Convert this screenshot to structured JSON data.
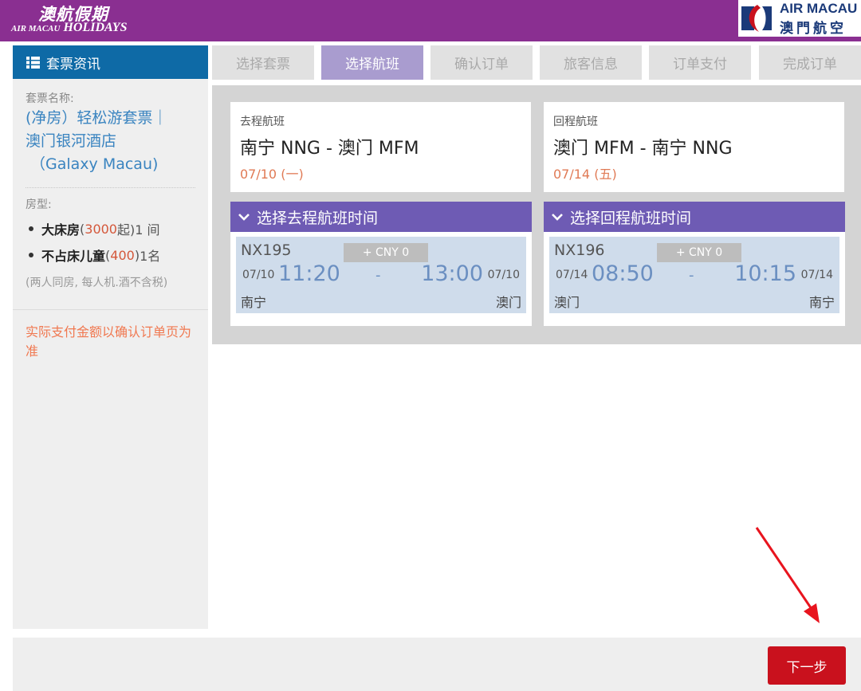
{
  "header": {
    "brand_cn": "澳航假期",
    "brand_en_prefix": "AIR MACAU",
    "brand_en_suffix": "HOLIDAYS",
    "airline_en": "AIR MACAU",
    "airline_cn": "澳門航空",
    "colors": {
      "header_bg": "#8a2f91"
    }
  },
  "sidebar": {
    "title": "套票资讯",
    "title_icon": "list-icon",
    "package_label": "套票名称:",
    "package_name_line1": "(净房）轻松游套票｜",
    "package_name_line2": "澳门银河酒店",
    "package_name_line3": "（Galaxy Macau)",
    "room_label": "房型:",
    "rooms": [
      {
        "name": "大床房",
        "price_open": "(",
        "price": "3000",
        "price_close": "起) ",
        "qty": "1 间"
      },
      {
        "name": "不占床儿童",
        "price_open": " (",
        "price": "400",
        "price_close": ") ",
        "qty": "1名"
      }
    ],
    "note": "(两人同房, 每人机.酒不含税)",
    "warning": "实际支付金额以确认订单页为准"
  },
  "steps": [
    {
      "label": "选择套票",
      "active": false
    },
    {
      "label": "选择航班",
      "active": true
    },
    {
      "label": "确认订单",
      "active": false
    },
    {
      "label": "旅客信息",
      "active": false
    },
    {
      "label": "订单支付",
      "active": false
    },
    {
      "label": "完成订单",
      "active": false
    }
  ],
  "outbound": {
    "label": "去程航班",
    "route": "南宁 NNG - 澳门 MFM",
    "date": "07/10 (一)",
    "select_title": "选择去程航班时间",
    "flight": {
      "number": "NX195",
      "price": "+ CNY 0",
      "dep_date": "07/10",
      "dep_time": "11:20",
      "separator": "-",
      "arr_time": "13:00",
      "arr_date": "07/10",
      "from_city": "南宁",
      "to_city": "澳门"
    }
  },
  "return": {
    "label": "回程航班",
    "route": "澳门 MFM - 南宁 NNG",
    "date": "07/14 (五)",
    "select_title": "选择回程航班时间",
    "flight": {
      "number": "NX196",
      "price": "+ CNY 0",
      "dep_date": "07/14",
      "dep_time": "08:50",
      "separator": "-",
      "arr_time": "10:15",
      "arr_date": "07/14",
      "from_city": "澳门",
      "to_city": "南宁"
    }
  },
  "footer": {
    "next_label": "下一步",
    "colors": {
      "next_bg": "#c9111d"
    }
  }
}
